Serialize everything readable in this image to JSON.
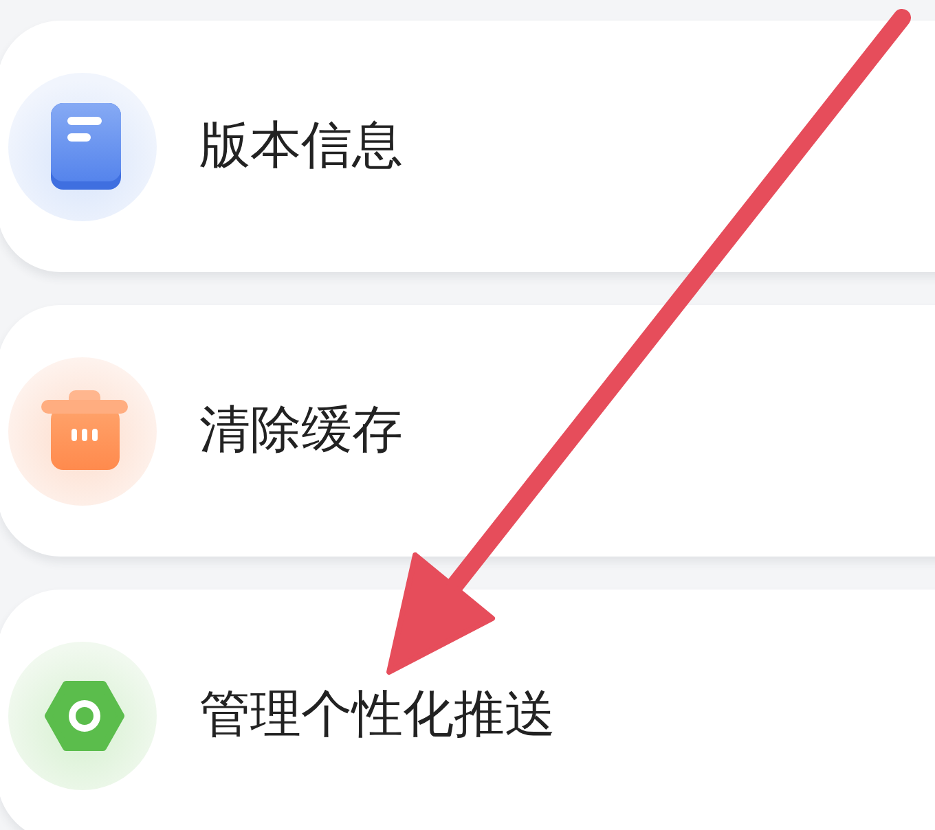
{
  "items": [
    {
      "label": "版本信息"
    },
    {
      "label": "清除缓存"
    },
    {
      "label": "管理个性化推送"
    }
  ]
}
